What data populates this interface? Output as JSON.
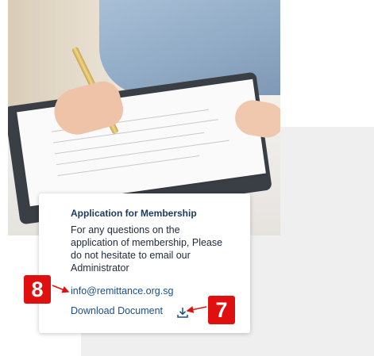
{
  "card": {
    "title": "Application for Membership",
    "body": "For any questions on the application of membership, Please do not hesitate to email our Administrator",
    "email": "info@remittance.org.sg",
    "download_label": "Download Document"
  },
  "annotations": {
    "marker_8": "8",
    "marker_7": "7"
  },
  "icons": {
    "download": "download-icon"
  },
  "colors": {
    "link": "#1b4f8a",
    "title": "#1b3a5e",
    "marker": "#e01010",
    "panel": "#efefef"
  }
}
